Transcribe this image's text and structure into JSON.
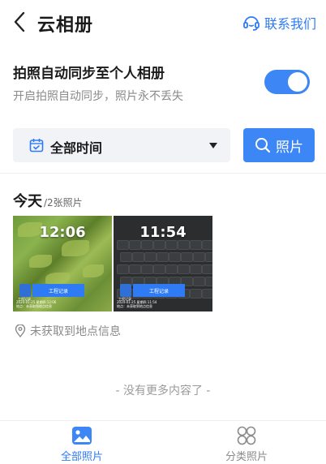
{
  "header": {
    "title": "云相册",
    "contact_label": "联系我们"
  },
  "sync": {
    "title": "拍照自动同步至个人相册",
    "subtitle": "开启拍照自动同步，照片永不丢失",
    "enabled": true
  },
  "filter": {
    "time_label": "全部时间",
    "search_label": "照片"
  },
  "section": {
    "day": "今天",
    "count": "/2张照片"
  },
  "photos": [
    {
      "time": "12:06",
      "record_label": "工程记录",
      "stamp_label": "工程记录",
      "meta_line1": "2024-01-25 星期四 12:06",
      "meta_line2": "地点：未获取到地点信息"
    },
    {
      "time": "11:54",
      "record_label": "工程记录",
      "stamp_label": "工程记录",
      "meta_line1": "2024-01-25 星期四 11:54",
      "meta_line2": "地点：未获取到地点信息"
    }
  ],
  "location": {
    "text": "未获取到地点信息"
  },
  "footer": {
    "no_more": "- 没有更多内容了 -"
  },
  "tabbar": {
    "tabs": [
      {
        "label": "全部照片",
        "icon": "photo-icon",
        "active": true
      },
      {
        "label": "分类照片",
        "icon": "category-icon",
        "active": false
      }
    ]
  },
  "colors": {
    "accent": "#2f7bf3",
    "toggle_on": "#3d86f5"
  }
}
